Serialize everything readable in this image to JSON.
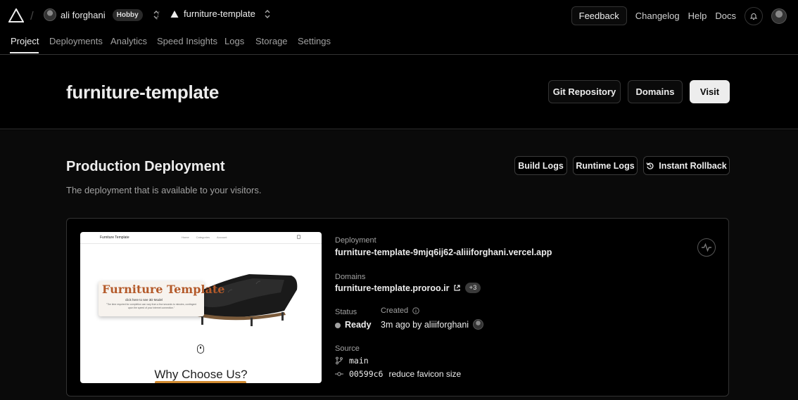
{
  "topbar": {
    "user_name": "ali forghani",
    "plan_badge": "Hobby",
    "project_name": "furniture-template",
    "feedback_label": "Feedback",
    "changelog_label": "Changelog",
    "help_label": "Help",
    "docs_label": "Docs"
  },
  "tabs": [
    "Project",
    "Deployments",
    "Analytics",
    "Speed Insights",
    "Logs",
    "Storage",
    "Settings"
  ],
  "header": {
    "title": "furniture-template",
    "git_repository_label": "Git Repository",
    "domains_label": "Domains",
    "visit_label": "Visit"
  },
  "production": {
    "title": "Production Deployment",
    "subtitle": "The deployment that is available to your visitors.",
    "build_logs_label": "Build Logs",
    "runtime_logs_label": "Runtime Logs",
    "instant_rollback_label": "Instant Rollback"
  },
  "preview": {
    "brand": "Furniture Template",
    "nav_links": [
      "Home",
      "Categories",
      "Account"
    ],
    "hero_title": "Furniture Template",
    "hero_cta": "click here to see 3D Model",
    "hero_note": "\"The time required for completion can vary from a few seconds to minutes, contingent upon the speed of your internet connection.\"",
    "section_heading": "Why Choose Us?"
  },
  "deployment": {
    "deployment_label": "Deployment",
    "deployment_url": "furniture-template-9mjq6ij62-aliiiforghani.vercel.app",
    "domains_label": "Domains",
    "domain": "furniture-template.proroo.ir",
    "extra_domains": "+3",
    "status_label": "Status",
    "status_value": "Ready",
    "created_label": "Created",
    "created_value": "3m ago by aliiiforghani",
    "source_label": "Source",
    "branch": "main",
    "commit_hash": "00599c6",
    "commit_message": "reduce favicon size"
  },
  "colors": {
    "background": "#000000",
    "section_background": "#0a0a0a",
    "border": "#333333",
    "text": "#ededed",
    "muted": "#a1a1a1",
    "visit_button": "#ededed"
  }
}
